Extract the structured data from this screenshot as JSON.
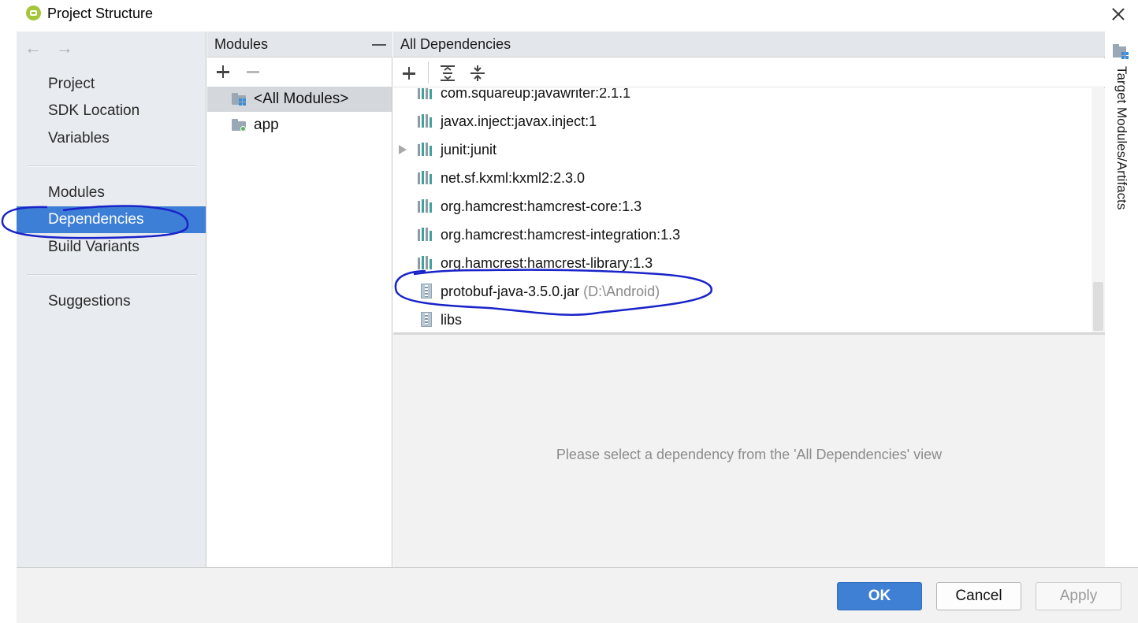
{
  "window": {
    "title": "Project Structure",
    "app_icon": "android-studio-icon",
    "close_icon": "close-icon"
  },
  "nav": {
    "back_icon": "←",
    "forward_icon": "→",
    "items": [
      {
        "label": "Project"
      },
      {
        "label": "SDK Location"
      },
      {
        "label": "Variables"
      },
      {
        "label": "Modules"
      },
      {
        "label": "Dependencies",
        "selected": true
      },
      {
        "label": "Build Variants"
      },
      {
        "label": "Suggestions"
      }
    ]
  },
  "modules_panel": {
    "header": "Modules",
    "items": [
      {
        "label": "<All Modules>",
        "selected": true
      },
      {
        "label": "app"
      }
    ]
  },
  "deps_panel": {
    "header": "All Dependencies",
    "items": [
      {
        "label": "com.squareup:javawriter:2.1.1"
      },
      {
        "label": "javax.inject:javax.inject:1"
      },
      {
        "label": "junit:junit",
        "expandable": true
      },
      {
        "label": "net.sf.kxml:kxml2:2.3.0"
      },
      {
        "label": "org.hamcrest:hamcrest-core:1.3"
      },
      {
        "label": "org.hamcrest:hamcrest-integration:1.3"
      },
      {
        "label": "org.hamcrest:hamcrest-library:1.3"
      },
      {
        "label": "protobuf-java-3.5.0.jar",
        "path": "(D:\\Android)"
      },
      {
        "label": "libs"
      }
    ],
    "details_message": "Please select a dependency from the 'All Dependencies' view"
  },
  "side_strip": {
    "label": "Target Modules/Artifacts"
  },
  "buttons": {
    "ok": "OK",
    "cancel": "Cancel",
    "apply": "Apply"
  },
  "colors": {
    "selection": "#3d7fd6",
    "annotation_ink": "#1a23c8",
    "library_icon_teal": "#3fa39c",
    "library_icon_gray": "#8f9aa6"
  }
}
